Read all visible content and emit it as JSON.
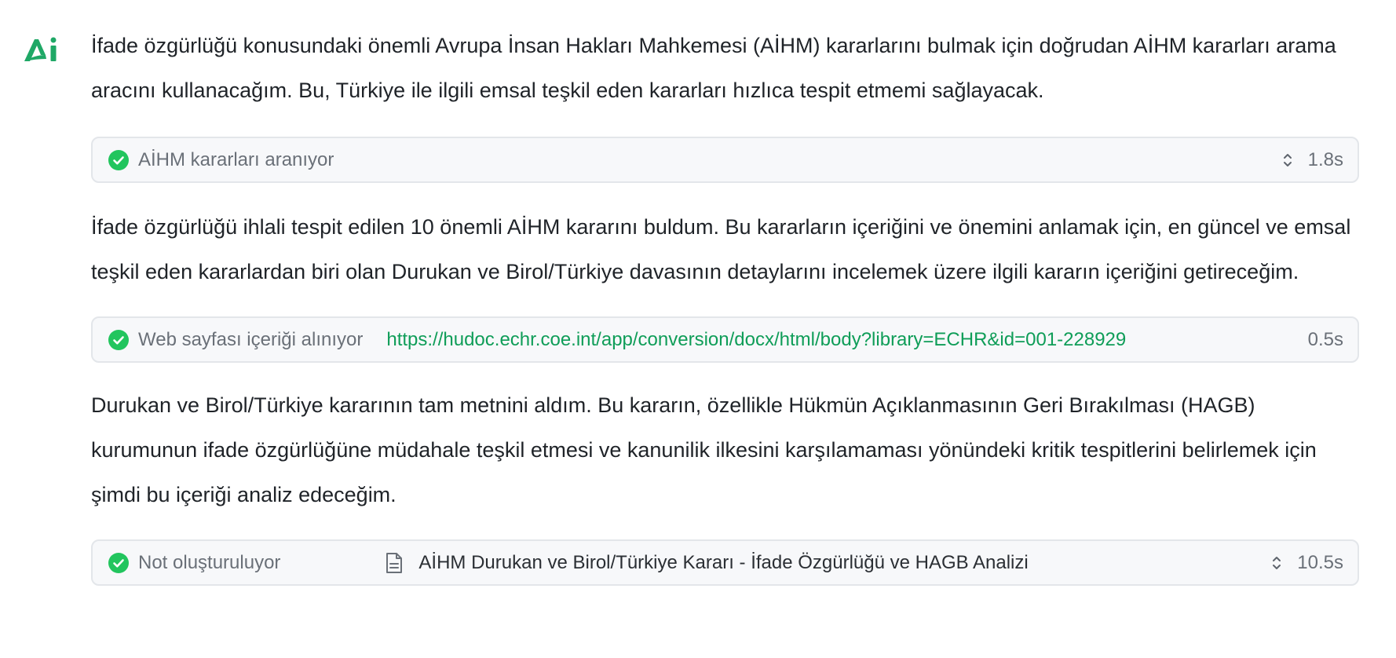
{
  "assistant": {
    "logo_icon": "ai-logo-icon",
    "accent_color": "#1fa866"
  },
  "messages": [
    {
      "text": "İfade özgürlüğü konusundaki önemli Avrupa İnsan Hakları Mahkemesi (AİHM) kararlarını bulmak için doğrudan AİHM kararları arama aracını kullanacağım. Bu, Türkiye ile ilgili emsal teşkil eden kararları hızlıca tespit etmemi sağlayacak."
    },
    {
      "text": "İfade özgürlüğü ihlali tespit edilen 10 önemli AİHM kararını buldum. Bu kararların içeriğini ve önemini anlamak için, en güncel ve emsal teşkil eden kararlardan biri olan Durukan ve Birol/Türkiye davasının detaylarını incelemek üzere ilgili kararın içeriğini getireceğim."
    },
    {
      "text": "Durukan ve Birol/Türkiye kararının tam metnini aldım. Bu kararın, özellikle Hükmün Açıklanmasının Geri Bırakılması (HAGB) kurumunun ifade özgürlüğüne müdahale teşkil etmesi ve kanunilik ilkesini karşılamaması yönündeki kritik tespitlerini belirlemek için şimdi bu içeriği analiz edeceğim."
    }
  ],
  "tools": [
    {
      "status_icon": "check-circle-icon",
      "label": "AİHM kararları aranıyor",
      "expand_icon": "chevron-up-down-icon",
      "duration": "1.8s"
    },
    {
      "status_icon": "check-circle-icon",
      "label": "Web sayfası içeriği alınıyor",
      "url": "https://hudoc.echr.coe.int/app/conversion/docx/html/body?library=ECHR&id=001-228929",
      "duration": "0.5s"
    },
    {
      "status_icon": "check-circle-icon",
      "label": "Not oluşturuluyor",
      "doc_icon": "document-icon",
      "doc_title": "AİHM Durukan ve Birol/Türkiye Kararı - İfade Özgürlüğü ve HAGB Analizi",
      "expand_icon": "chevron-up-down-icon",
      "duration": "10.5s"
    }
  ]
}
